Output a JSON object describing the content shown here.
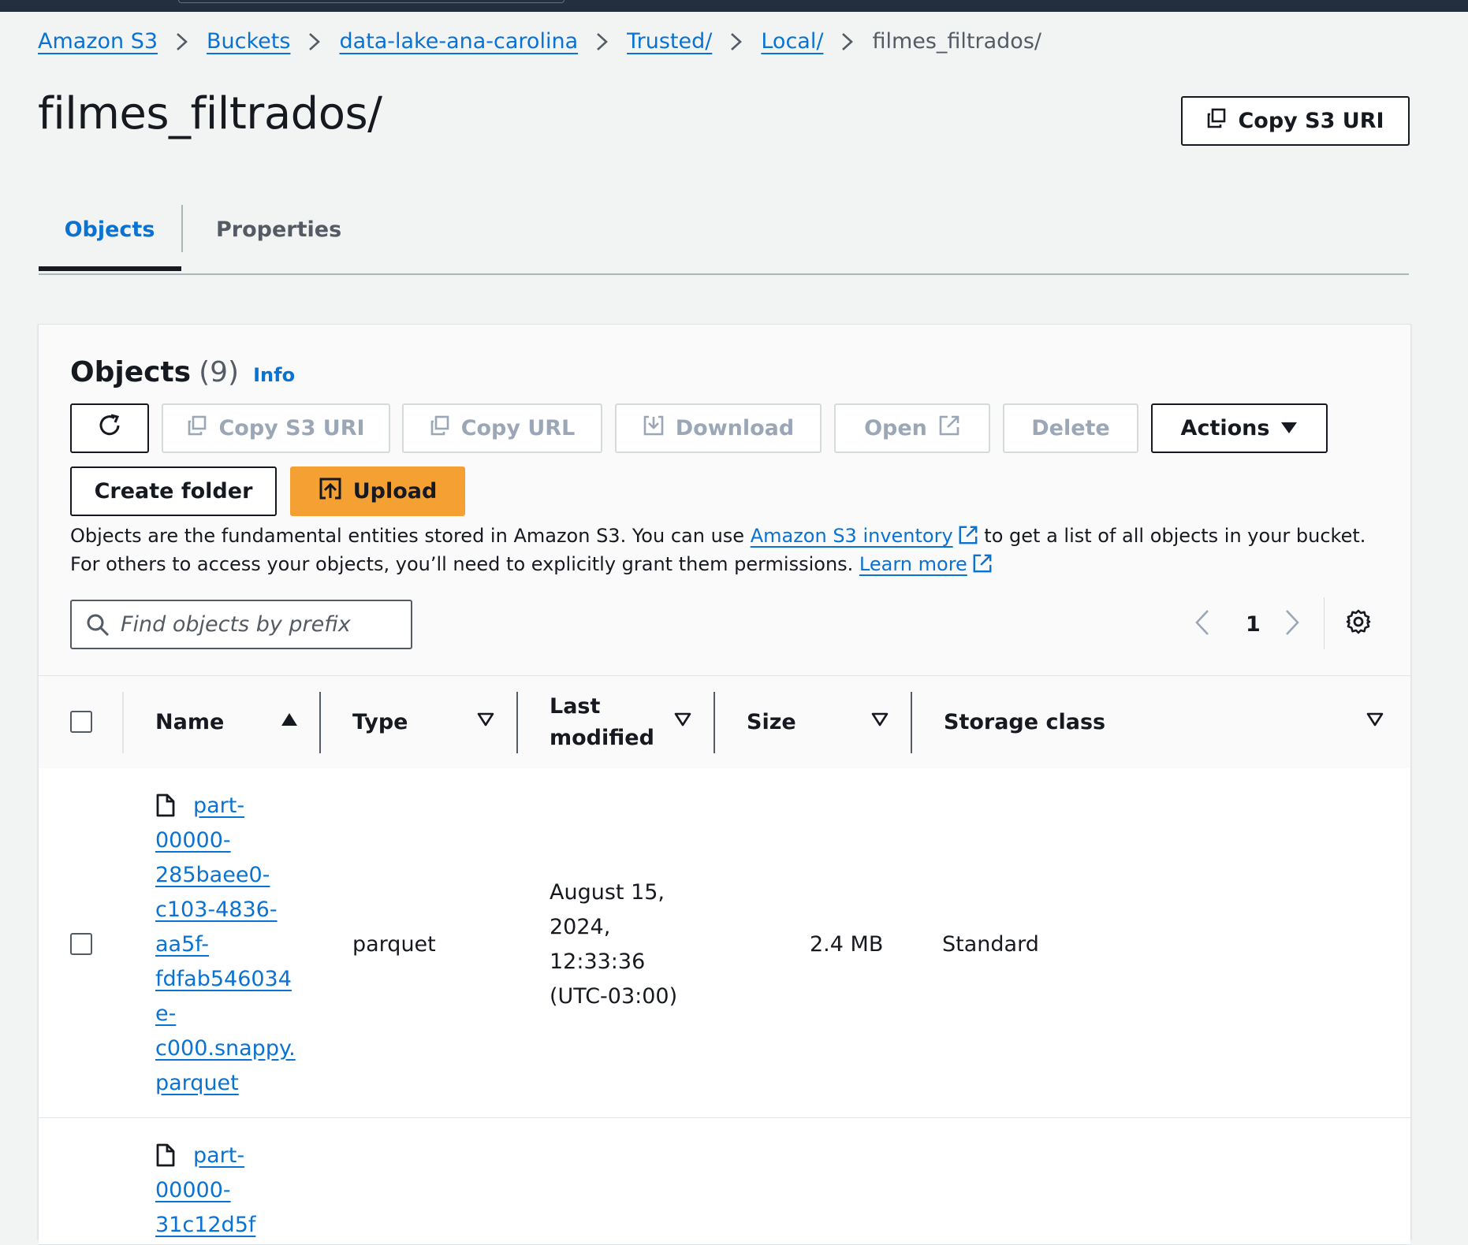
{
  "breadcrumb": {
    "items": [
      "Amazon S3",
      "Buckets",
      "data-lake-ana-carolina",
      "Trusted/",
      "Local/"
    ],
    "current": "filmes_filtrados/"
  },
  "page": {
    "title": "filmes_filtrados/",
    "copy_uri_label": "Copy S3 URI"
  },
  "tabs": {
    "objects": "Objects",
    "properties": "Properties"
  },
  "objects_panel": {
    "title": "Objects",
    "count": "(9)",
    "info": "Info",
    "toolbar": {
      "copy_s3_uri": "Copy S3 URI",
      "copy_url": "Copy URL",
      "download": "Download",
      "open": "Open",
      "delete": "Delete",
      "actions": "Actions",
      "create_folder": "Create folder",
      "upload": "Upload"
    },
    "description": {
      "text_1": "Objects are the fundamental entities stored in Amazon S3. You can use ",
      "link_1": "Amazon S3 inventory",
      "text_2": " to get a list of all objects in your bucket. For others to access your objects, you’ll need to explicitly grant them permissions. ",
      "link_2": "Learn more"
    },
    "search_placeholder": "Find objects by prefix",
    "page_number": "1"
  },
  "table": {
    "columns": {
      "name": "Name",
      "type": "Type",
      "last_modified_1": "Last",
      "last_modified_2": "modified",
      "size": "Size",
      "storage_class": "Storage class"
    },
    "rows": [
      {
        "name_lines": [
          "part-",
          "00000-",
          "285baee0-",
          "c103-4836-",
          "aa5f-",
          "fdfab546034",
          "e-",
          "c000.snappy.",
          "parquet"
        ],
        "type": "parquet",
        "modified_lines": [
          "August 15,",
          "2024,",
          "12:33:36",
          "(UTC-03:00)"
        ],
        "size": "2.4 MB",
        "storage_class": "Standard"
      },
      {
        "name_lines": [
          "part-",
          "00000-",
          "31c12d5f"
        ]
      }
    ]
  },
  "colors": {
    "link": "#0972d3",
    "primary": "#f5a033",
    "topbar": "#232f3e"
  }
}
